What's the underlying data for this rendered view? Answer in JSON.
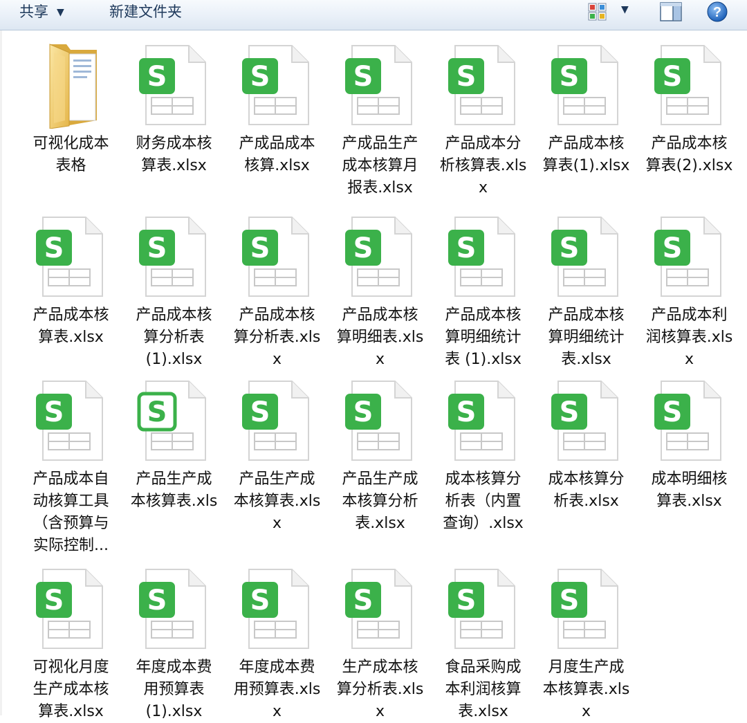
{
  "toolbar": {
    "share_label": "共享",
    "new_folder_label": "新建文件夹"
  },
  "icons": {
    "folder": "folder-icon",
    "spreadsheet": "wps-spreadsheet-s-icon",
    "view": "change-view-icon",
    "preview_pane": "preview-pane-icon",
    "help": "help-icon"
  },
  "colors": {
    "wps_green": "#3bb14a",
    "folder_yellow": "#f2cf6a"
  },
  "files": [
    {
      "name": "可视化成本表格",
      "type": "folder"
    },
    {
      "name": "财务成本核算表.xlsx",
      "type": "xlsx"
    },
    {
      "name": "产成品成本核算.xlsx",
      "type": "xlsx"
    },
    {
      "name": "产成品生产成本核算月报表.xlsx",
      "type": "xlsx"
    },
    {
      "name": "产品成本分析核算表.xlsx",
      "type": "xlsx"
    },
    {
      "name": "产品成本核算表(1).xlsx",
      "type": "xlsx"
    },
    {
      "name": "产品成本核算表(2).xlsx",
      "type": "xlsx"
    },
    {
      "name": "产品成本核算表.xlsx",
      "type": "xlsx"
    },
    {
      "name": "产品成本核算分析表(1).xlsx",
      "type": "xlsx"
    },
    {
      "name": "产品成本核算分析表.xlsx",
      "type": "xlsx"
    },
    {
      "name": "产品成本核算明细表.xlsx",
      "type": "xlsx"
    },
    {
      "name": "产品成本核算明细统计表 (1).xlsx",
      "type": "xlsx"
    },
    {
      "name": "产品成本核算明细统计表.xlsx",
      "type": "xlsx"
    },
    {
      "name": "产品成本利润核算表.xlsx",
      "type": "xlsx"
    },
    {
      "name": "产品成本自动核算工具（含预算与实际控制...",
      "type": "xlsx"
    },
    {
      "name": "产品生产成本核算表.xls",
      "type": "xls"
    },
    {
      "name": "产品生产成本核算表.xlsx",
      "type": "xlsx"
    },
    {
      "name": "产品生产成本核算分析表.xlsx",
      "type": "xlsx"
    },
    {
      "name": "成本核算分析表（内置查询）.xlsx",
      "type": "xlsx"
    },
    {
      "name": "成本核算分析表.xlsx",
      "type": "xlsx"
    },
    {
      "name": "成本明细核算表.xlsx",
      "type": "xlsx"
    },
    {
      "name": "可视化月度生产成本核算表.xlsx",
      "type": "xlsx"
    },
    {
      "name": "年度成本费用预算表(1).xlsx",
      "type": "xlsx"
    },
    {
      "name": "年度成本费用预算表.xlsx",
      "type": "xlsx"
    },
    {
      "name": "生产成本核算分析表.xlsx",
      "type": "xlsx"
    },
    {
      "name": "食品采购成本利润核算表.xlsx",
      "type": "xlsx"
    },
    {
      "name": "月度生产成本核算表.xlsx",
      "type": "xlsx"
    }
  ]
}
